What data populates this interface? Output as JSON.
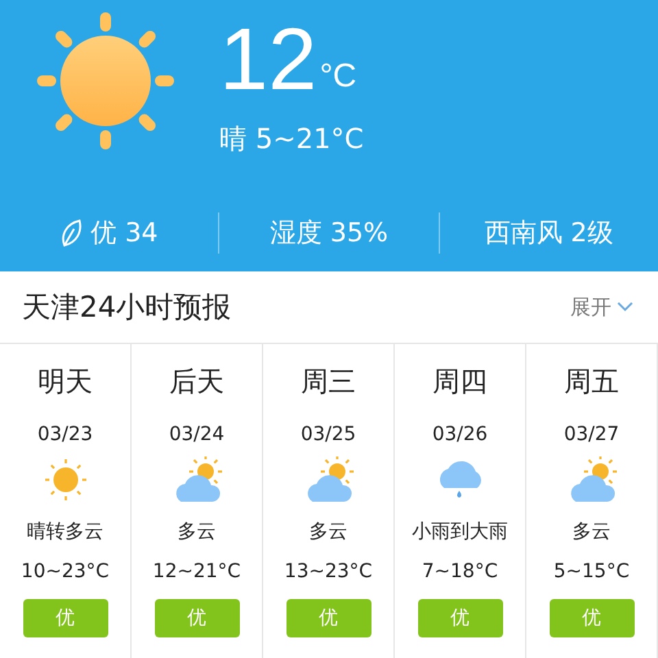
{
  "current": {
    "temperature": "12",
    "unit": "°C",
    "summary": "晴 5~21°C"
  },
  "stats": [
    {
      "kind": "leaf",
      "text": "优 34"
    },
    {
      "kind": "plain",
      "text": "湿度 35%"
    },
    {
      "kind": "plain",
      "text": "西南风 2级"
    }
  ],
  "forecast": {
    "title": "天津24小时预报",
    "expand": "展开",
    "days": [
      {
        "day": "明天",
        "date": "03/23",
        "kind": "sunny",
        "condition": "晴转多云",
        "range": "10~23°C",
        "air": "优"
      },
      {
        "day": "后天",
        "date": "03/24",
        "kind": "partly_cloudy",
        "condition": "多云",
        "range": "12~21°C",
        "air": "优"
      },
      {
        "day": "周三",
        "date": "03/25",
        "kind": "partly_cloudy",
        "condition": "多云",
        "range": "13~23°C",
        "air": "优"
      },
      {
        "day": "周四",
        "date": "03/26",
        "kind": "rain",
        "condition": "小雨到大雨",
        "range": "7~18°C",
        "air": "优"
      },
      {
        "day": "周五",
        "date": "03/27",
        "kind": "partly_cloudy",
        "condition": "多云",
        "range": "5~15°C",
        "air": "优"
      }
    ]
  }
}
